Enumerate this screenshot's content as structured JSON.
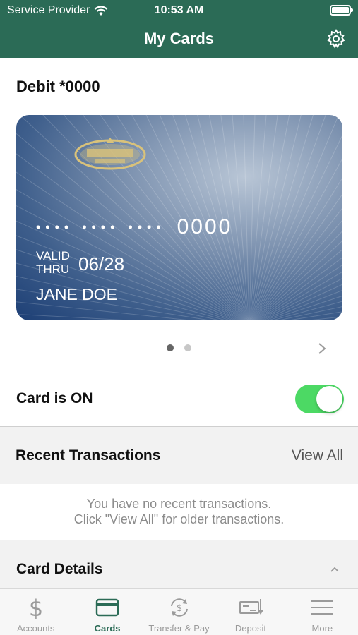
{
  "status_bar": {
    "carrier": "Service Provider",
    "time": "10:53 AM"
  },
  "header": {
    "title": "My Cards"
  },
  "card": {
    "name": "Debit *0000",
    "number_masked": "•••• •••• ••••",
    "number_last4": "0000",
    "valid_label_1": "VALID",
    "valid_label_2": "THRU",
    "expiry": "06/28",
    "holder": "JANE DOE",
    "logo_icon": "farmers-bank-logo"
  },
  "pager": {
    "pages": 2,
    "current": 1
  },
  "card_toggle": {
    "label": "Card is ON",
    "on": true,
    "color": "#4cd964"
  },
  "recent_transactions": {
    "title": "Recent Transactions",
    "view_all": "View All",
    "empty_line1": "You have no recent transactions.",
    "empty_line2": "Click \"View All\" for older transactions."
  },
  "card_details": {
    "title": "Card Details"
  },
  "tabs": [
    {
      "label": "Accounts",
      "icon": "dollar-icon",
      "active": false
    },
    {
      "label": "Cards",
      "icon": "card-icon",
      "active": true
    },
    {
      "label": "Transfer & Pay",
      "icon": "transfer-icon",
      "active": false
    },
    {
      "label": "Deposit",
      "icon": "deposit-check-icon",
      "active": false
    },
    {
      "label": "More",
      "icon": "menu-icon",
      "active": false
    }
  ],
  "colors": {
    "brand": "#2b6b56",
    "toggle_on": "#4cd964"
  }
}
